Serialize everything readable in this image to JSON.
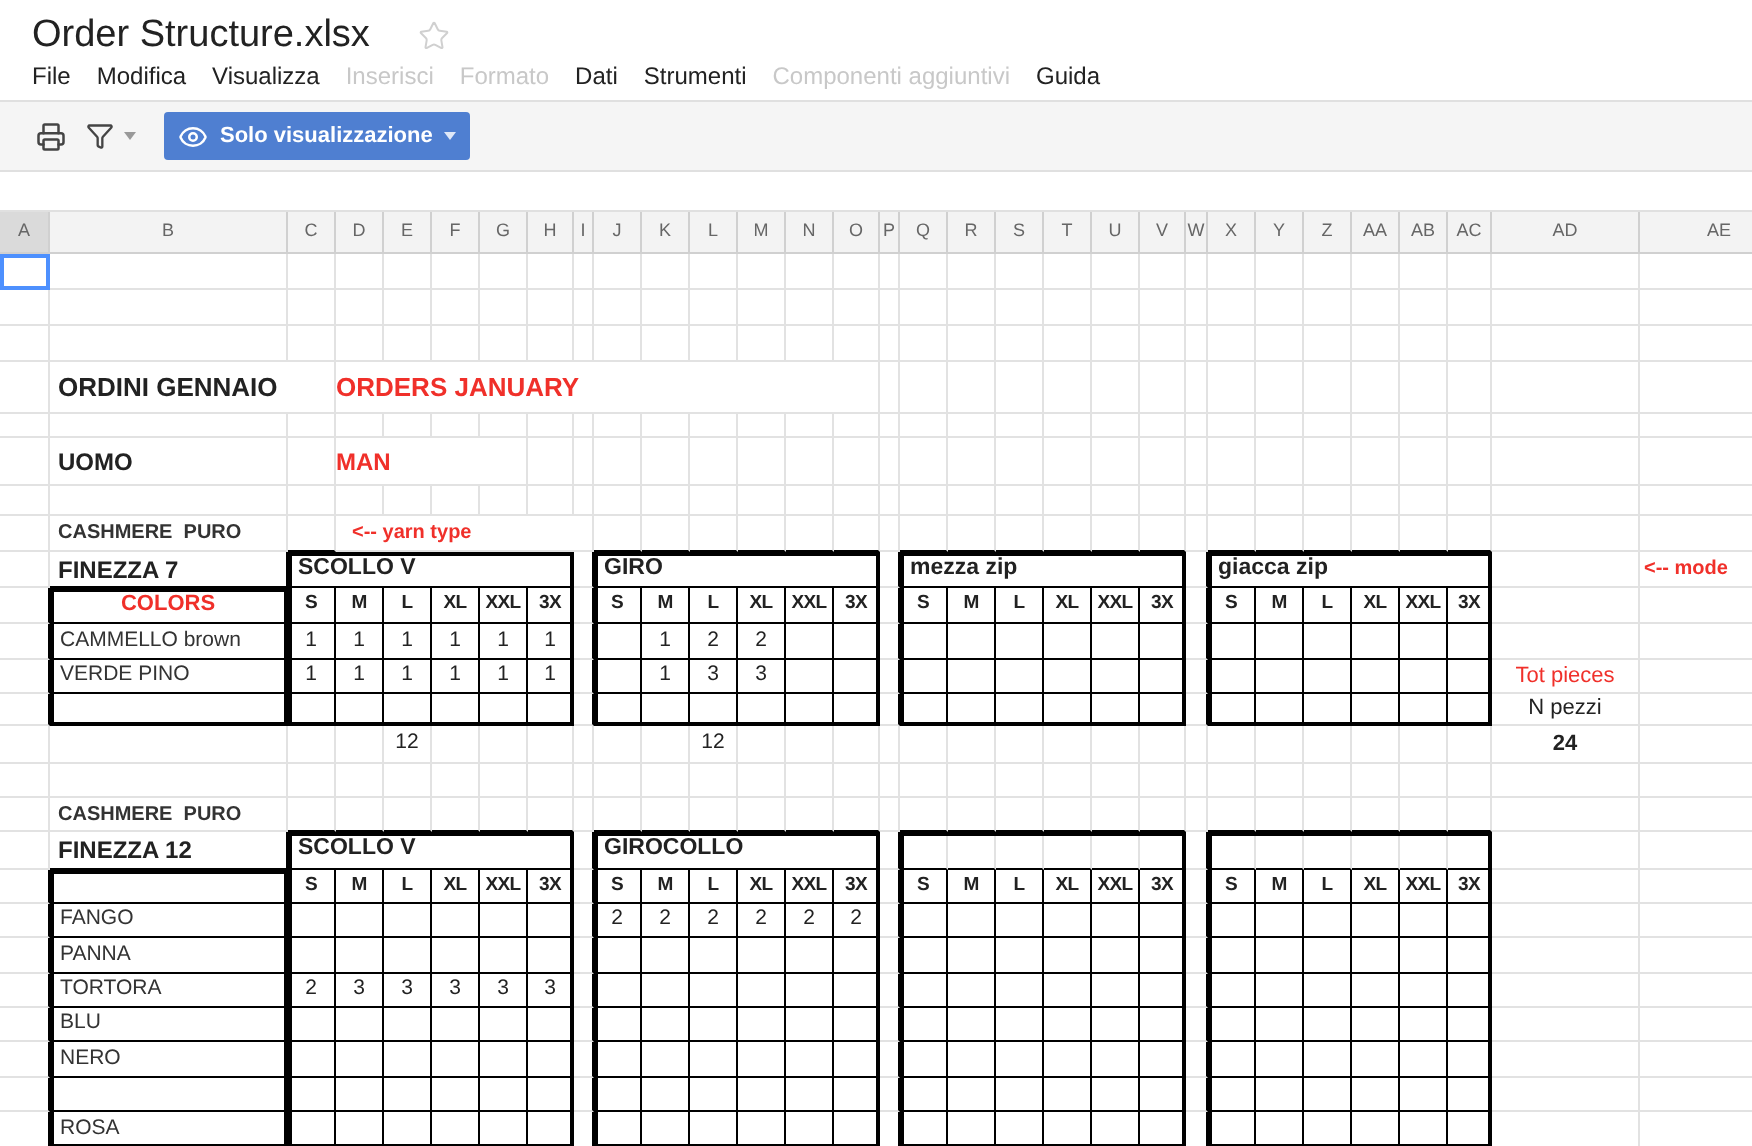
{
  "document": {
    "title": "Order Structure.xlsx",
    "starred": false
  },
  "menu": [
    {
      "label": "File",
      "disabled": false
    },
    {
      "label": "Modifica",
      "disabled": false
    },
    {
      "label": "Visualizza",
      "disabled": false
    },
    {
      "label": "Inserisci",
      "disabled": true
    },
    {
      "label": "Formato",
      "disabled": true
    },
    {
      "label": "Dati",
      "disabled": false
    },
    {
      "label": "Strumenti",
      "disabled": false
    },
    {
      "label": "Componenti aggiuntivi",
      "disabled": true
    },
    {
      "label": "Guida",
      "disabled": false
    }
  ],
  "toolbar": {
    "view_mode": "Solo visualizzazione"
  },
  "columns": [
    {
      "label": "A",
      "selected": true
    },
    {
      "label": "B",
      "selected": false
    },
    {
      "label": "C",
      "selected": false
    },
    {
      "label": "D",
      "selected": false
    },
    {
      "label": "E",
      "selected": false
    },
    {
      "label": "F",
      "selected": false
    },
    {
      "label": "G",
      "selected": false
    },
    {
      "label": "H",
      "selected": false
    },
    {
      "label": "I",
      "selected": false
    },
    {
      "label": "J",
      "selected": false
    },
    {
      "label": "K",
      "selected": false
    },
    {
      "label": "L",
      "selected": false
    },
    {
      "label": "M",
      "selected": false
    },
    {
      "label": "N",
      "selected": false
    },
    {
      "label": "O",
      "selected": false
    },
    {
      "label": "P",
      "selected": false
    },
    {
      "label": "Q",
      "selected": false
    },
    {
      "label": "R",
      "selected": false
    },
    {
      "label": "S",
      "selected": false
    },
    {
      "label": "T",
      "selected": false
    },
    {
      "label": "U",
      "selected": false
    },
    {
      "label": "V",
      "selected": false
    },
    {
      "label": "W",
      "selected": false
    },
    {
      "label": "X",
      "selected": false
    },
    {
      "label": "Y",
      "selected": false
    },
    {
      "label": "Z",
      "selected": false
    },
    {
      "label": "AA",
      "selected": false
    },
    {
      "label": "AB",
      "selected": false
    },
    {
      "label": "AC",
      "selected": false
    },
    {
      "label": "AD",
      "selected": false
    },
    {
      "label": "AE",
      "selected": false
    }
  ],
  "sheet": {
    "heading": "ORDINI GENNAIO",
    "heading_en": "ORDERS JANUARY",
    "category": "UOMO",
    "category_en": "MAN",
    "sections": [
      {
        "yarn": "CASHMERE  PURO",
        "yarn_note": "<-- yarn type",
        "gauge": "FINEZZA 7",
        "model_note": "<-- mode",
        "size_header_label": "COLORS",
        "models": [
          {
            "title": "SCOLLO V",
            "sizes": [
              "S",
              "M",
              "L",
              "XL",
              "XXL",
              "3X"
            ]
          },
          {
            "title": "GIRO",
            "sizes": [
              "S",
              "M",
              "L",
              "XL",
              "XXL",
              "3X"
            ]
          },
          {
            "title": "mezza zip",
            "sizes": [
              "S",
              "M",
              "L",
              "XL",
              "XXL",
              "3X"
            ]
          },
          {
            "title": "giacca zip",
            "sizes": [
              "S",
              "M",
              "L",
              "XL",
              "XXL",
              "3X"
            ]
          }
        ],
        "rows": [
          {
            "kind": "color",
            "label": "CAMMELLO brown",
            "cells": [
              [
                "1",
                "1",
                "1",
                "1",
                "1",
                "1"
              ],
              [
                null,
                "1",
                "2",
                "2"
              ]
            ]
          },
          {
            "kind": "color",
            "label": "VERDE PINO",
            "cells": [
              [
                "1",
                "1",
                "1",
                "1",
                "1",
                "1"
              ],
              [
                null,
                "1",
                "3",
                "3"
              ]
            ]
          },
          {
            "kind": "blank"
          }
        ],
        "totals": [
          "12",
          "12"
        ],
        "summary": {
          "tot_label": "Tot pieces",
          "count_label": "N pezzi",
          "grand_total": "24"
        }
      },
      {
        "yarn": "CASHMERE  PURO",
        "gauge": "FINEZZA 12",
        "models": [
          {
            "title": "SCOLLO V",
            "sizes": [
              "S",
              "M",
              "L",
              "XL",
              "XXL",
              "3X"
            ]
          },
          {
            "title": "GIROCOLLO",
            "sizes": [
              "S",
              "M",
              "L",
              "XL",
              "XXL",
              "3X"
            ]
          },
          {
            "sizes": [
              "S",
              "M",
              "L",
              "XL",
              "XXL",
              "3X"
            ]
          },
          {
            "sizes": [
              "S",
              "M",
              "L",
              "XL",
              "XXL",
              "3X"
            ]
          }
        ],
        "rows": [
          {
            "kind": "color",
            "label": "FANGO",
            "cells": [
              null,
              [
                "2",
                "2",
                "2",
                "2",
                "2",
                "2"
              ]
            ]
          },
          {
            "kind": "color",
            "label": "PANNA"
          },
          {
            "kind": "color",
            "label": "TORTORA",
            "cells": [
              [
                "2",
                "3",
                "3",
                "3",
                "3",
                "3"
              ]
            ]
          },
          {
            "kind": "color",
            "label": "BLU"
          },
          {
            "kind": "color",
            "label": "NERO"
          },
          {
            "kind": "blank"
          },
          {
            "kind": "color",
            "label": "ROSA"
          }
        ]
      }
    ]
  }
}
